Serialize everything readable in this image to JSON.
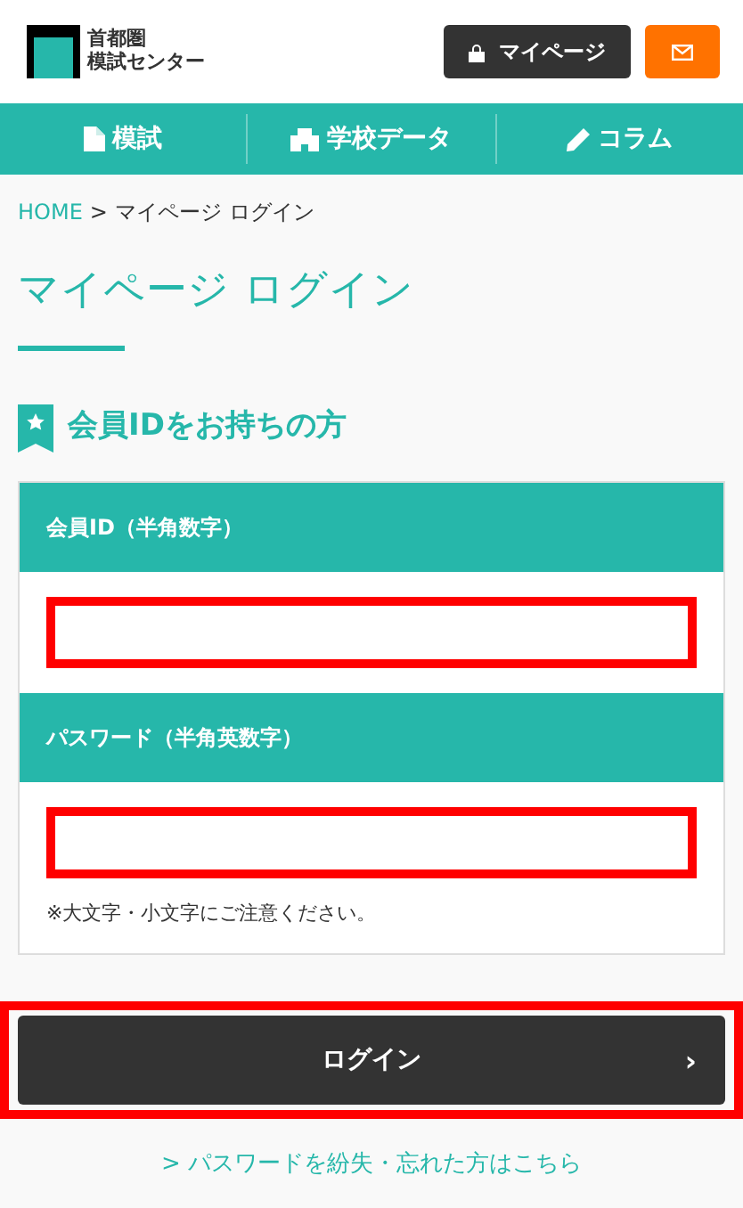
{
  "header": {
    "logo": {
      "line_1": "首都圏",
      "line_2": "模試センター"
    },
    "mypage_button": "マイページ"
  },
  "nav": [
    {
      "label": "模試",
      "kind": "document"
    },
    {
      "label": "学校データ",
      "kind": "building"
    },
    {
      "label": "コラム",
      "kind": "pencil"
    }
  ],
  "breadcrumb": {
    "home": "HOME",
    "separator": ">",
    "current": "マイページ ログイン"
  },
  "page_title": "マイページ ログイン",
  "section_heading": "会員IDをお持ちの方",
  "form": {
    "fields": [
      {
        "label": "会員ID（半角数字）",
        "highlighted": true
      },
      {
        "label": "パスワード（半角英数字）",
        "highlighted": true
      }
    ],
    "note": "※大文字・小文字にご注意ください。"
  },
  "login_button": {
    "label": "ログイン",
    "arrow": "›",
    "highlighted": true
  },
  "forgot_link": {
    "arrow": ">",
    "label": "パスワードを紛失・忘れた方はこちら"
  }
}
